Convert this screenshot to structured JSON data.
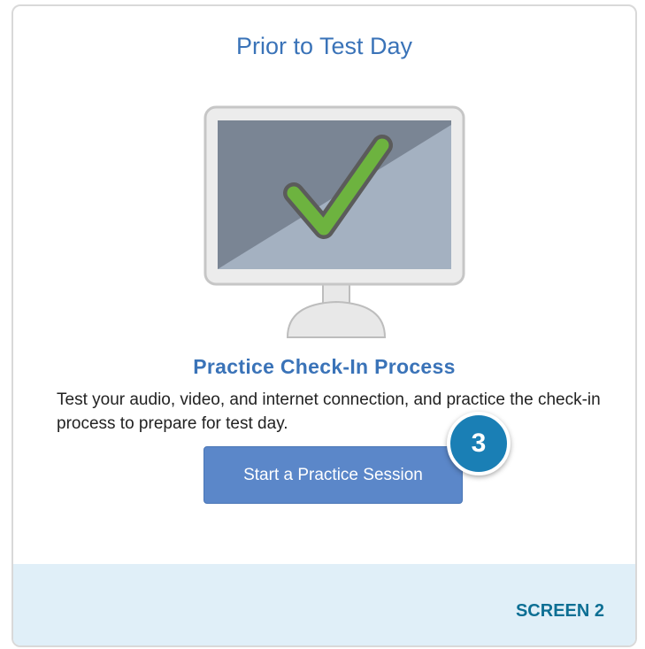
{
  "card": {
    "title": "Prior to Test Day",
    "heading": "Practice Check-In Process",
    "description": "Test your audio, video, and internet connection, and practice the check-in process to prepare for test day.",
    "button_label": "Start a Practice Session"
  },
  "callout": {
    "number": "3",
    "color": "#1a7fb5"
  },
  "footer": {
    "label": "SCREEN 2"
  },
  "colors": {
    "accent": "#3a73b8",
    "button": "#5b87c9",
    "check": "#6db33f",
    "footer_bg": "#e0eff8"
  },
  "icons": {
    "illustration": "monitor-check-icon"
  }
}
